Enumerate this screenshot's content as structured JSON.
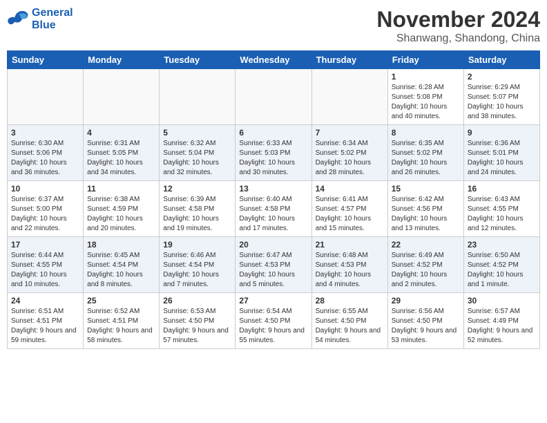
{
  "header": {
    "logo_line1": "General",
    "logo_line2": "Blue",
    "title": "November 2024",
    "subtitle": "Shanwang, Shandong, China"
  },
  "weekdays": [
    "Sunday",
    "Monday",
    "Tuesday",
    "Wednesday",
    "Thursday",
    "Friday",
    "Saturday"
  ],
  "weeks": [
    [
      {
        "day": "",
        "info": ""
      },
      {
        "day": "",
        "info": ""
      },
      {
        "day": "",
        "info": ""
      },
      {
        "day": "",
        "info": ""
      },
      {
        "day": "",
        "info": ""
      },
      {
        "day": "1",
        "info": "Sunrise: 6:28 AM\nSunset: 5:08 PM\nDaylight: 10 hours and 40 minutes."
      },
      {
        "day": "2",
        "info": "Sunrise: 6:29 AM\nSunset: 5:07 PM\nDaylight: 10 hours and 38 minutes."
      }
    ],
    [
      {
        "day": "3",
        "info": "Sunrise: 6:30 AM\nSunset: 5:06 PM\nDaylight: 10 hours and 36 minutes."
      },
      {
        "day": "4",
        "info": "Sunrise: 6:31 AM\nSunset: 5:05 PM\nDaylight: 10 hours and 34 minutes."
      },
      {
        "day": "5",
        "info": "Sunrise: 6:32 AM\nSunset: 5:04 PM\nDaylight: 10 hours and 32 minutes."
      },
      {
        "day": "6",
        "info": "Sunrise: 6:33 AM\nSunset: 5:03 PM\nDaylight: 10 hours and 30 minutes."
      },
      {
        "day": "7",
        "info": "Sunrise: 6:34 AM\nSunset: 5:02 PM\nDaylight: 10 hours and 28 minutes."
      },
      {
        "day": "8",
        "info": "Sunrise: 6:35 AM\nSunset: 5:02 PM\nDaylight: 10 hours and 26 minutes."
      },
      {
        "day": "9",
        "info": "Sunrise: 6:36 AM\nSunset: 5:01 PM\nDaylight: 10 hours and 24 minutes."
      }
    ],
    [
      {
        "day": "10",
        "info": "Sunrise: 6:37 AM\nSunset: 5:00 PM\nDaylight: 10 hours and 22 minutes."
      },
      {
        "day": "11",
        "info": "Sunrise: 6:38 AM\nSunset: 4:59 PM\nDaylight: 10 hours and 20 minutes."
      },
      {
        "day": "12",
        "info": "Sunrise: 6:39 AM\nSunset: 4:58 PM\nDaylight: 10 hours and 19 minutes."
      },
      {
        "day": "13",
        "info": "Sunrise: 6:40 AM\nSunset: 4:58 PM\nDaylight: 10 hours and 17 minutes."
      },
      {
        "day": "14",
        "info": "Sunrise: 6:41 AM\nSunset: 4:57 PM\nDaylight: 10 hours and 15 minutes."
      },
      {
        "day": "15",
        "info": "Sunrise: 6:42 AM\nSunset: 4:56 PM\nDaylight: 10 hours and 13 minutes."
      },
      {
        "day": "16",
        "info": "Sunrise: 6:43 AM\nSunset: 4:55 PM\nDaylight: 10 hours and 12 minutes."
      }
    ],
    [
      {
        "day": "17",
        "info": "Sunrise: 6:44 AM\nSunset: 4:55 PM\nDaylight: 10 hours and 10 minutes."
      },
      {
        "day": "18",
        "info": "Sunrise: 6:45 AM\nSunset: 4:54 PM\nDaylight: 10 hours and 8 minutes."
      },
      {
        "day": "19",
        "info": "Sunrise: 6:46 AM\nSunset: 4:54 PM\nDaylight: 10 hours and 7 minutes."
      },
      {
        "day": "20",
        "info": "Sunrise: 6:47 AM\nSunset: 4:53 PM\nDaylight: 10 hours and 5 minutes."
      },
      {
        "day": "21",
        "info": "Sunrise: 6:48 AM\nSunset: 4:53 PM\nDaylight: 10 hours and 4 minutes."
      },
      {
        "day": "22",
        "info": "Sunrise: 6:49 AM\nSunset: 4:52 PM\nDaylight: 10 hours and 2 minutes."
      },
      {
        "day": "23",
        "info": "Sunrise: 6:50 AM\nSunset: 4:52 PM\nDaylight: 10 hours and 1 minute."
      }
    ],
    [
      {
        "day": "24",
        "info": "Sunrise: 6:51 AM\nSunset: 4:51 PM\nDaylight: 9 hours and 59 minutes."
      },
      {
        "day": "25",
        "info": "Sunrise: 6:52 AM\nSunset: 4:51 PM\nDaylight: 9 hours and 58 minutes."
      },
      {
        "day": "26",
        "info": "Sunrise: 6:53 AM\nSunset: 4:50 PM\nDaylight: 9 hours and 57 minutes."
      },
      {
        "day": "27",
        "info": "Sunrise: 6:54 AM\nSunset: 4:50 PM\nDaylight: 9 hours and 55 minutes."
      },
      {
        "day": "28",
        "info": "Sunrise: 6:55 AM\nSunset: 4:50 PM\nDaylight: 9 hours and 54 minutes."
      },
      {
        "day": "29",
        "info": "Sunrise: 6:56 AM\nSunset: 4:50 PM\nDaylight: 9 hours and 53 minutes."
      },
      {
        "day": "30",
        "info": "Sunrise: 6:57 AM\nSunset: 4:49 PM\nDaylight: 9 hours and 52 minutes."
      }
    ]
  ]
}
